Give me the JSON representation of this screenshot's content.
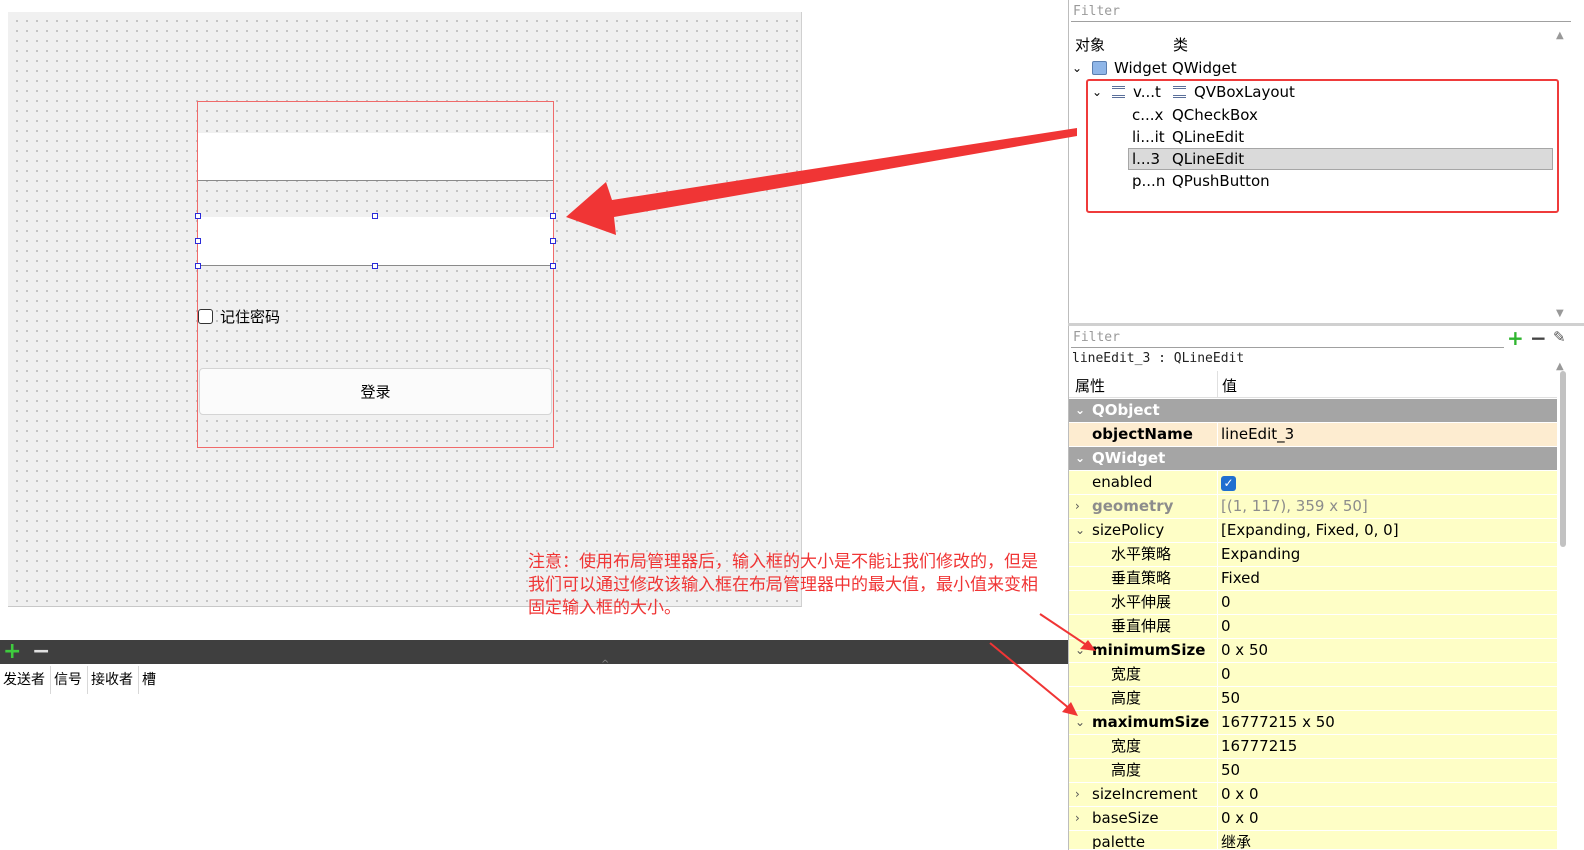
{
  "canvas": {
    "checkbox_label": "记住密码",
    "login_button": "登录"
  },
  "signal_editor": {
    "columns": [
      "发送者",
      "信号",
      "接收者",
      "槽"
    ]
  },
  "object_inspector": {
    "filter_placeholder": "Filter",
    "col_object": "对象",
    "col_class": "类",
    "tree": [
      {
        "name": "Widget",
        "class": "QWidget"
      },
      {
        "name": "v...t",
        "class": "QVBoxLayout"
      },
      {
        "name": "c...x",
        "class": "QCheckBox"
      },
      {
        "name": "li...it",
        "class": "QLineEdit"
      },
      {
        "name": "l...3",
        "class": "QLineEdit"
      },
      {
        "name": "p...n",
        "class": "QPushButton"
      }
    ]
  },
  "property_editor": {
    "filter_placeholder": "Filter",
    "object_label": "lineEdit_3 : QLineEdit",
    "col_property": "属性",
    "col_value": "值",
    "rows": {
      "qobject": "QObject",
      "objectName": {
        "name": "objectName",
        "value": "lineEdit_3"
      },
      "qwidget": "QWidget",
      "enabled": {
        "name": "enabled",
        "value": "✓"
      },
      "geometry": {
        "name": "geometry",
        "value": "[(1, 117), 359 x 50]"
      },
      "sizePolicy": {
        "name": "sizePolicy",
        "value": "[Expanding, Fixed, 0, 0]"
      },
      "hpolicy": {
        "name": "水平策略",
        "value": "Expanding"
      },
      "vpolicy": {
        "name": "垂直策略",
        "value": "Fixed"
      },
      "hstretch": {
        "name": "水平伸展",
        "value": "0"
      },
      "vstretch": {
        "name": "垂直伸展",
        "value": "0"
      },
      "minimumSize": {
        "name": "minimumSize",
        "value": "0 x 50"
      },
      "minWidth": {
        "name": "宽度",
        "value": "0"
      },
      "minHeight": {
        "name": "高度",
        "value": "50"
      },
      "maximumSize": {
        "name": "maximumSize",
        "value": "16777215 x 50"
      },
      "maxWidth": {
        "name": "宽度",
        "value": "16777215"
      },
      "maxHeight": {
        "name": "高度",
        "value": "50"
      },
      "sizeIncrement": {
        "name": "sizeIncrement",
        "value": "0 x 0"
      },
      "baseSize": {
        "name": "baseSize",
        "value": "0 x 0"
      },
      "palette": {
        "name": "palette",
        "value": "继承"
      }
    }
  },
  "annotation": "注意：使用布局管理器后，输入框的大小是不能让我们修改的，但是我们可以通过修改该输入框在布局管理器中的最大值，最小值来变相固定输入框的大小。",
  "colors": {
    "annotation": "#f03535",
    "accent": "#1f6fd0",
    "category_row": "#a5a5a5",
    "property_row": "#fefec6"
  }
}
